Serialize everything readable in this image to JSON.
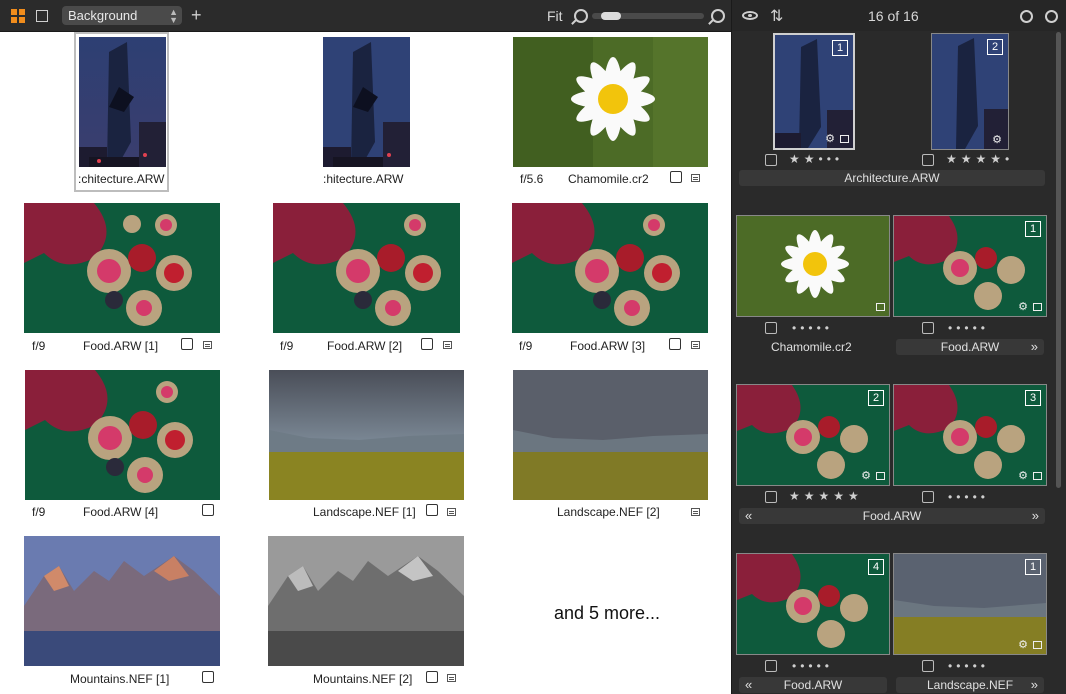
{
  "toolbar": {
    "collection": "Background",
    "fit_label": "Fit",
    "zoom_level": 0.15
  },
  "grid": {
    "items": [
      {
        "name": ":chitecture.ARW",
        "aperture": ""
      },
      {
        "name": ":hitecture.ARW",
        "aperture": ""
      },
      {
        "name": "Chamomile.cr2",
        "aperture": "f/5.6"
      },
      {
        "name": "Food.ARW [1]",
        "aperture": "f/9"
      },
      {
        "name": "Food.ARW [2]",
        "aperture": "f/9"
      },
      {
        "name": "Food.ARW [3]",
        "aperture": "f/9"
      },
      {
        "name": "Food.ARW [4]",
        "aperture": "f/9"
      },
      {
        "name": "Landscape.NEF [1]",
        "aperture": ""
      },
      {
        "name": "Landscape.NEF [2]",
        "aperture": ""
      },
      {
        "name": "Mountains.NEF [1]",
        "aperture": ""
      },
      {
        "name": "Mountains.NEF [2]",
        "aperture": ""
      }
    ],
    "more_text": "and 5 more..."
  },
  "panel": {
    "count": "16 of 16",
    "thumbs": [
      {
        "badge": "1",
        "rating": 2
      },
      {
        "badge": "2",
        "rating": 4
      },
      {
        "badge": "",
        "rating": 0
      },
      {
        "badge": "1",
        "rating": 0
      },
      {
        "badge": "2",
        "rating": 5
      },
      {
        "badge": "3",
        "rating": 0
      },
      {
        "badge": "4",
        "rating": 0
      },
      {
        "badge": "1",
        "rating": 0
      }
    ],
    "labels": {
      "architecture": "Architecture.ARW",
      "chamomile": "Chamomile.cr2",
      "food_a": "Food.ARW",
      "food_b": "Food.ARW",
      "food_c": "Food.ARW",
      "landscape": "Landscape.NEF"
    }
  },
  "colors": {
    "accent": "#f08c1c",
    "panel_bg": "#2a2a2a"
  }
}
